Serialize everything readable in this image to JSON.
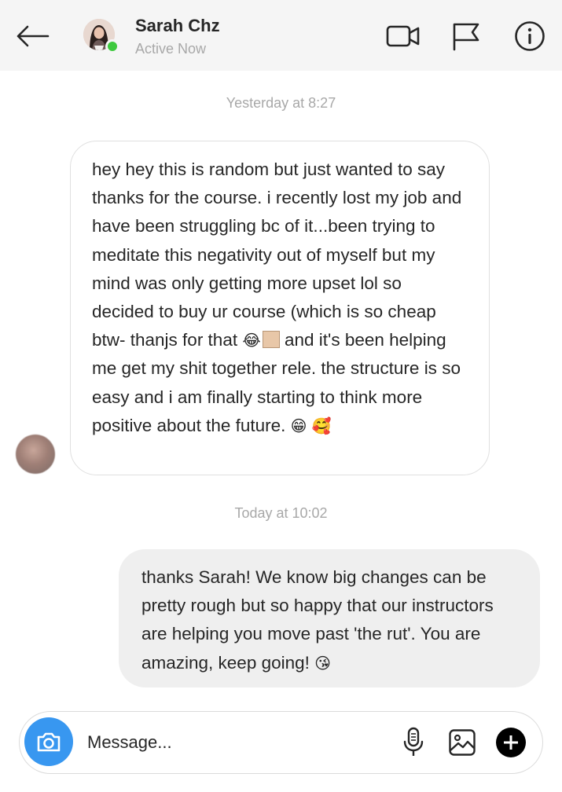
{
  "header": {
    "name": "Sarah Chz",
    "status": "Active Now",
    "back_icon": "arrow-left-icon",
    "video_icon": "video-camera-icon",
    "flag_icon": "flag-icon",
    "info_icon": "info-icon"
  },
  "colors": {
    "header_bg": "#f5f5f5",
    "online_dot": "#3ec93e",
    "camera_button": "#3897f0",
    "outgoing_bubble": "#efefef",
    "muted_text": "#a8a8a8"
  },
  "conversation": {
    "timestamp_1": "Yesterday at 8:27",
    "incoming": {
      "part1": "hey hey this is random but just wanted to say thanks for the course. i recently lost my job and have been struggling bc of it...been trying to meditate this negativity out of myself but my mind was only getting more upset lol so decided to buy ur course (which is so cheap btw- thanjs for that",
      "emoji1": "😂",
      "part2": " and it's been helping me get my shit together rele. the structure is so easy and i am finally starting to think more positive about the future. ",
      "emoji2": "😁 🥰"
    },
    "timestamp_2": "Today at 10:02",
    "outgoing": {
      "text": "thanks Sarah! We know big changes can be pretty rough but so happy that our instructors are helping you move past 'the rut'. You are amazing, keep going! ",
      "emoji": "😘"
    }
  },
  "composer": {
    "placeholder": "Message...",
    "camera_icon": "camera-icon",
    "mic_icon": "microphone-icon",
    "image_icon": "image-icon",
    "plus_icon": "plus-circle-icon"
  }
}
